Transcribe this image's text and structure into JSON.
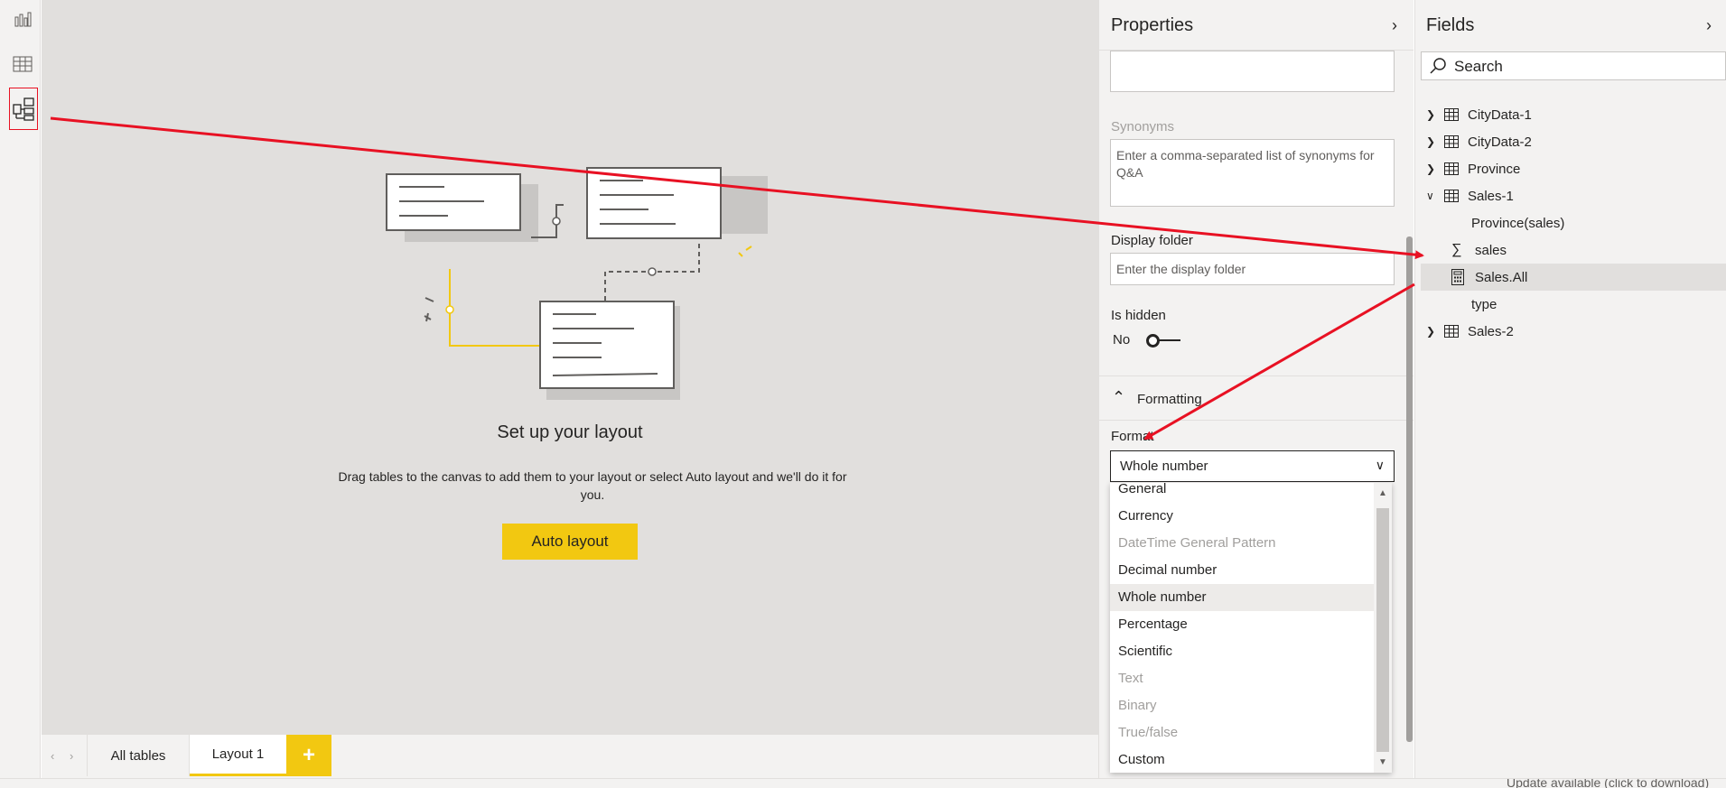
{
  "left_nav": {
    "items": [
      {
        "name": "report-view",
        "icon": "bar-chart-icon"
      },
      {
        "name": "data-view",
        "icon": "table-icon"
      },
      {
        "name": "model-view",
        "icon": "model-icon",
        "selected": true
      }
    ]
  },
  "canvas": {
    "title": "Set up your layout",
    "description": "Drag tables to the canvas to add them to your layout or select Auto layout and we'll do it for you.",
    "auto_layout_label": "Auto layout"
  },
  "tabs": {
    "items": [
      "All tables",
      "Layout 1"
    ],
    "active": "Layout 1",
    "add_label": "+"
  },
  "properties": {
    "title": "Properties",
    "synonyms_label": "Synonyms",
    "synonyms_placeholder": "Enter a comma-separated list of synonyms for Q&A",
    "display_folder_label": "Display folder",
    "display_folder_placeholder": "Enter the display folder",
    "is_hidden_label": "Is hidden",
    "is_hidden_value": "No",
    "formatting_label": "Formatting",
    "format_label": "Format",
    "format_value": "Whole number",
    "format_options": [
      {
        "label": "General",
        "disabled": false
      },
      {
        "label": "Currency",
        "disabled": false
      },
      {
        "label": "DateTime General Pattern",
        "disabled": true
      },
      {
        "label": "Decimal number",
        "disabled": false
      },
      {
        "label": "Whole number",
        "disabled": false,
        "selected": true
      },
      {
        "label": "Percentage",
        "disabled": false
      },
      {
        "label": "Scientific",
        "disabled": false
      },
      {
        "label": "Text",
        "disabled": true
      },
      {
        "label": "Binary",
        "disabled": true
      },
      {
        "label": "True/false",
        "disabled": true
      },
      {
        "label": "Custom",
        "disabled": false
      }
    ]
  },
  "fields": {
    "title": "Fields",
    "search_placeholder": "Search",
    "tree": [
      {
        "label": "CityData-1",
        "type": "table",
        "expanded": false,
        "level": 0
      },
      {
        "label": "CityData-2",
        "type": "table",
        "expanded": false,
        "level": 0
      },
      {
        "label": "Province",
        "type": "table",
        "expanded": false,
        "level": 0
      },
      {
        "label": "Sales-1",
        "type": "table",
        "expanded": true,
        "level": 0
      },
      {
        "label": "Province(sales)",
        "type": "column",
        "level": 1
      },
      {
        "label": "sales",
        "type": "sum",
        "level": 1
      },
      {
        "label": "Sales.All",
        "type": "measure",
        "level": 1,
        "selected": true
      },
      {
        "label": "type",
        "type": "column",
        "level": 1
      },
      {
        "label": "Sales-2",
        "type": "table",
        "expanded": false,
        "level": 0
      }
    ]
  },
  "status_bar": {
    "update_text": "Update available (click to download)"
  },
  "colors": {
    "accent": "#f2c811",
    "arrow": "#e81123",
    "pane_bg": "#f3f2f1",
    "canvas_bg": "#e1dfdd"
  }
}
